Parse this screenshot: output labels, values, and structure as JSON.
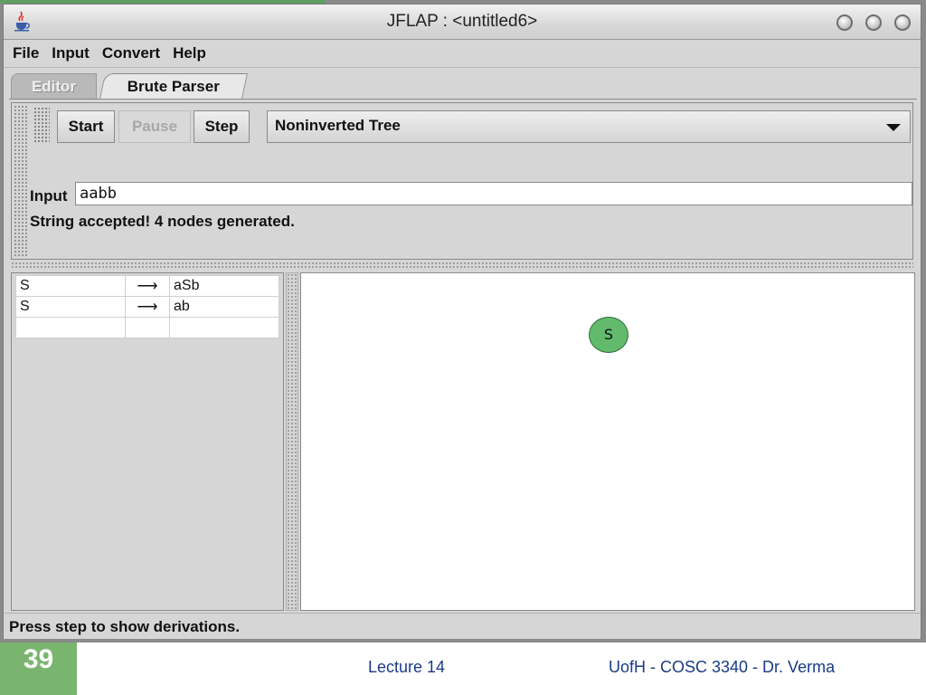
{
  "window": {
    "title": "JFLAP : <untitled6>"
  },
  "menu": {
    "items": [
      "File",
      "Input",
      "Convert",
      "Help"
    ]
  },
  "tabs": [
    {
      "label": "Editor",
      "active": false
    },
    {
      "label": "Brute Parser",
      "active": true
    }
  ],
  "toolbar": {
    "start_label": "Start",
    "pause_label": "Pause",
    "step_label": "Step",
    "view_select": "Noninverted Tree"
  },
  "input": {
    "label": "Input",
    "value": "aabb"
  },
  "status_message": "String accepted!  4 nodes generated.",
  "grammar": {
    "rows": [
      {
        "lhs": "S",
        "arrow": "⟶",
        "rhs": "aSb"
      },
      {
        "lhs": "S",
        "arrow": "⟶",
        "rhs": "ab"
      },
      {
        "lhs": "",
        "arrow": "",
        "rhs": ""
      }
    ]
  },
  "tree": {
    "nodes": [
      {
        "label": "S",
        "color": "#62bb6c"
      }
    ]
  },
  "statusbar": {
    "text": "Press step to show derivations."
  },
  "slide": {
    "number": "39",
    "footer_center": "Lecture 14",
    "footer_right": "UofH - COSC 3340 - Dr. Verma",
    "accent_color": "#79b56e",
    "footer_text_color": "#1a3a86"
  }
}
